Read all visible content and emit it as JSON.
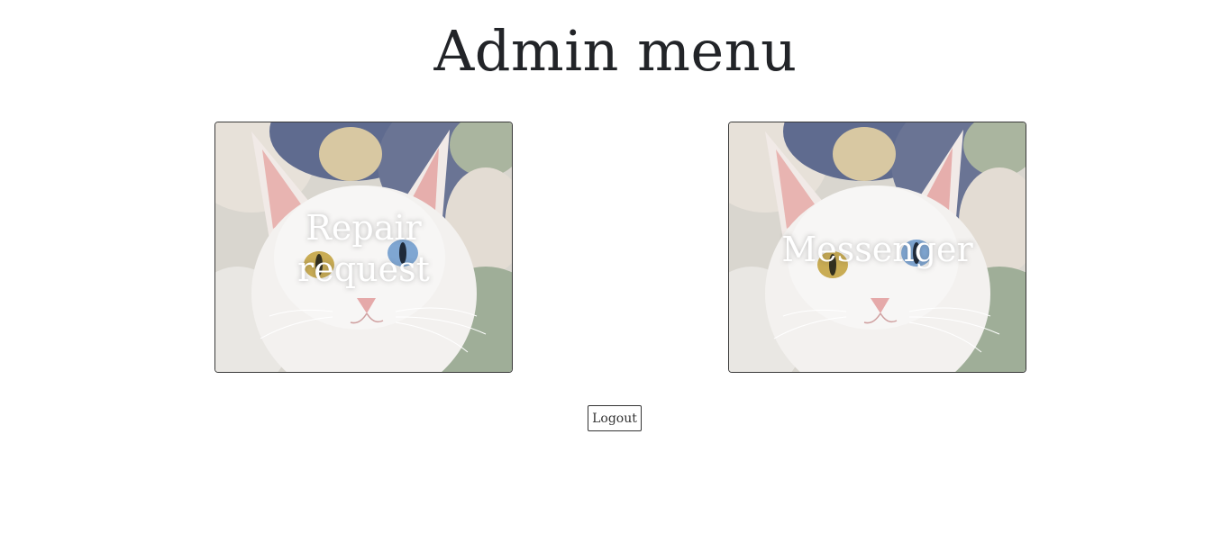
{
  "header": {
    "title": "Admin menu"
  },
  "cards": [
    {
      "label": "Repair\nrequest",
      "image": "white-cat-photo"
    },
    {
      "label": "Messenger",
      "image": "white-cat-photo"
    }
  ],
  "footer": {
    "logout_label": "Logout"
  },
  "colors": {
    "background": "#ffffff",
    "text": "#222428",
    "card_label": "#ffffff",
    "border": "#333333"
  }
}
